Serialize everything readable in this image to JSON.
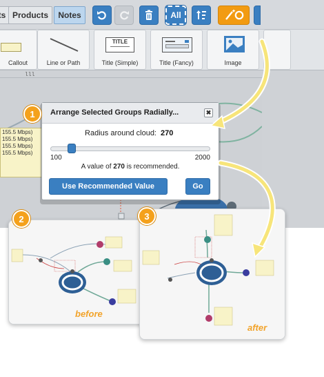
{
  "toolbar": {
    "tabs": [
      {
        "label": "ts"
      },
      {
        "label": "Products"
      },
      {
        "label": "Notes"
      }
    ],
    "buttons": [
      {
        "name": "undo",
        "icon": "undo-icon"
      },
      {
        "name": "redo",
        "icon": "redo-icon"
      },
      {
        "name": "delete",
        "icon": "trash-icon"
      },
      {
        "name": "select-all",
        "label": "All"
      },
      {
        "name": "sort",
        "icon": "sort-icon"
      },
      {
        "name": "magic",
        "icon": "magic-wand-icon"
      }
    ],
    "accent_blue": "#3a7fc1",
    "accent_orange": "#f29b12"
  },
  "shapes": [
    {
      "label": "Callout",
      "icon": "callout-icon"
    },
    {
      "label": "Line or Path",
      "icon": "line-icon"
    },
    {
      "label": "Title (Simple)",
      "icon": "title-simple-icon",
      "inner_text": "TITLE"
    },
    {
      "label": "Title (Fancy)",
      "icon": "title-fancy-icon"
    },
    {
      "label": "Image",
      "icon": "image-icon"
    }
  ],
  "canvas": {
    "rates": [
      "155.5 Mbps)",
      "155.5 Mbps)",
      "155.5 Mbps)",
      "155.5 Mbps)"
    ]
  },
  "dialog": {
    "title": "Arrange Selected Groups Radially...",
    "radius_label": "Radius around cloud:",
    "radius_value": "270",
    "slider_min": "100",
    "slider_max": "2000",
    "slider_value": 270,
    "recommend_prefix": "A value of ",
    "recommend_value": "270",
    "recommend_suffix": " is recommended.",
    "use_recommended_label": "Use Recommended Value",
    "go_label": "Go",
    "close_glyph": "✖"
  },
  "badges": [
    "1",
    "2",
    "3"
  ],
  "panels": {
    "before_label": "before",
    "after_label": "after"
  }
}
